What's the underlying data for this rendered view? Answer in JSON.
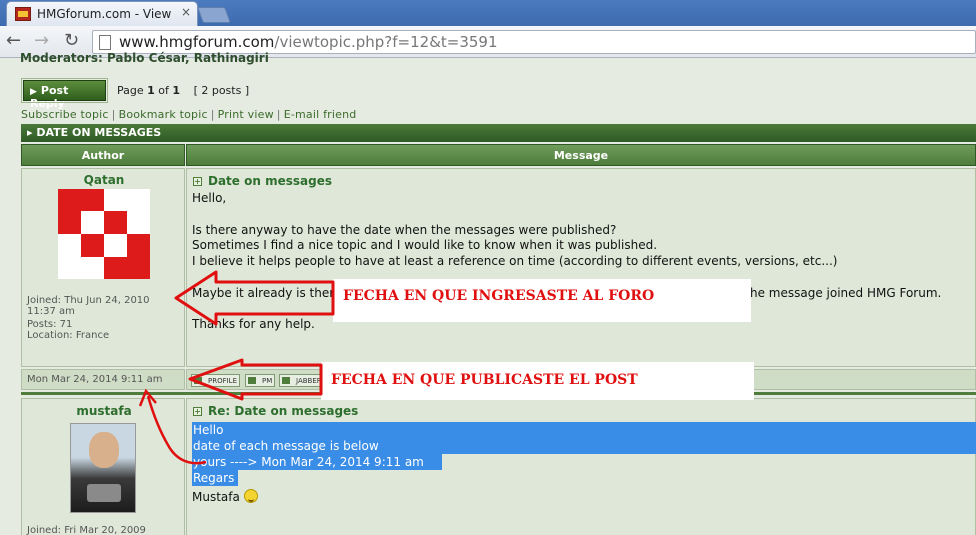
{
  "browser": {
    "tab_title": "HMGforum.com - View to",
    "tab_close": "×",
    "url_host": "www.hmgforum.com",
    "url_path": "/viewtopic.php?f=12&t=3591"
  },
  "forum": {
    "moderators_cut": "Moderators: Pablo César, Rathinagiri",
    "post_reply_label": "Post Reply",
    "page_prefix": "Page",
    "page_current": "1",
    "page_of": "of",
    "page_total": "1",
    "posts_count": "[ 2 posts ]",
    "links": [
      "Subscribe topic",
      "Bookmark topic",
      "Print view",
      "E-mail friend"
    ],
    "topic_title": "DATE ON MESSAGES",
    "col_author": "Author",
    "col_message": "Message"
  },
  "posts": [
    {
      "author": "Qatan",
      "joined": "Joined: Thu Jun 24, 2010",
      "joined_time": "11:37 am",
      "posts": "Posts: 71",
      "location": "Location: France",
      "subject": "Date on messages",
      "lines": [
        "Hello,",
        "",
        "Is there anyway to have the date when the messages were published?",
        "Sometimes I find a nice topic and I would like to know when it was published.",
        "I believe it helps people to have at least a reference on time (according to different events, versions, etc...)",
        "",
        "Maybe it already is there...",
        "",
        "Thanks for any help."
      ],
      "line7_tail": "he message joined HMG Forum.",
      "post_date": "Mon Mar 24, 2014 9:11 am",
      "btn_profile": "PROFILE",
      "btn_pm": "PM",
      "btn_jabber": "JABBER"
    },
    {
      "author": "mustafa",
      "joined": "Joined: Fri Mar 20, 2009",
      "subject": "Re: Date on messages",
      "hl_lines": [
        "Hello",
        "date of each message is below",
        "yours ----> Mon Mar 24, 2014 9:11 am"
      ],
      "regards": "Regars",
      "signature": "Mustafa"
    }
  ],
  "annotations": {
    "note1": "FECHA EN QUE INGRESASTE AL FORO",
    "note2": "FECHA EN QUE PUBLICASTE EL POST"
  }
}
